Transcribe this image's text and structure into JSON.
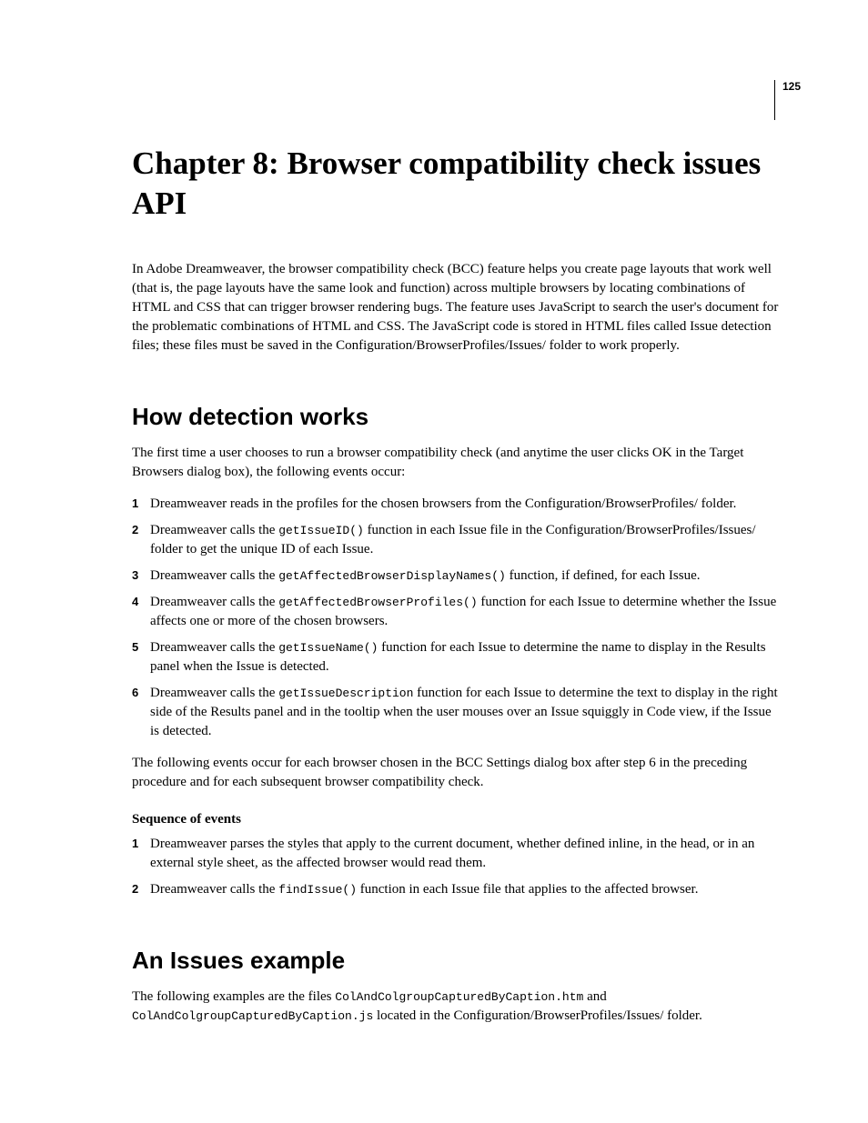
{
  "pageNumber": "125",
  "chapterTitle": "Chapter 8: Browser compatibility check issues API",
  "intro": {
    "pre": "In Adobe Dreamweaver, the browser compatibility check (BCC) feature helps you create page layouts that work well (that is, the page layouts have the same look and function) across multiple browsers by locating combinations of HTML and CSS that can trigger browser rendering bugs. The feature uses JavaScript to search the user's document for the problematic combinations of HTML and CSS. The JavaScript code is stored in HTML files called Issue detection files; these files must be saved in the Configuration/BrowserProfiles/Issues/ folder to work properly."
  },
  "section1": {
    "heading": "How detection works",
    "lead": "The first time a user chooses to run a browser compatibility check (and anytime the user clicks OK in the Target Browsers dialog box), the following events occur:",
    "items": [
      {
        "t1": "Dreamweaver reads in the profiles for the chosen browsers from the Configuration/BrowserProfiles/ folder."
      },
      {
        "t1": "Dreamweaver calls the ",
        "c1": "getIssueID()",
        "t2": " function in each Issue file in the Configuration/BrowserProfiles/Issues/ folder to get the unique ID of each Issue."
      },
      {
        "t1": "Dreamweaver calls the ",
        "c1": "getAffectedBrowserDisplayNames()",
        "t2": " function, if defined, for each Issue."
      },
      {
        "t1": "Dreamweaver calls the ",
        "c1": "getAffectedBrowserProfiles()",
        "t2": " function for each Issue to determine whether the Issue affects one or more of the chosen browsers."
      },
      {
        "t1": "Dreamweaver calls the ",
        "c1": "getIssueName()",
        "t2": " function for each Issue to determine the name to display in the Results panel when the Issue is detected."
      },
      {
        "t1": "Dreamweaver calls the ",
        "c1": "getIssueDescription",
        "t2": " function for each Issue to determine the text to display in the right side of the Results panel and in the tooltip when the user mouses over an Issue squiggly in Code view, if the Issue is detected."
      }
    ],
    "trail": "The following events occur for each browser chosen in the BCC Settings dialog box after step 6 in the preceding procedure and for each subsequent browser compatibility check.",
    "subheading": "Sequence of events",
    "seq": [
      {
        "t1": "Dreamweaver parses the styles that apply to the current document, whether defined inline, in the head, or in an external style sheet, as the affected browser would read them."
      },
      {
        "t1": "Dreamweaver calls the ",
        "c1": "findIssue()",
        "t2": " function in each Issue file that applies to the affected browser."
      }
    ]
  },
  "section2": {
    "heading": "An Issues example",
    "p": {
      "t1": "The following examples are the files ",
      "c1": "ColAndColgroupCapturedByCaption.htm",
      "t2": " and ",
      "c2": "ColAndColgroupCapturedByCaption.js",
      "t3": " located in the Configuration/BrowserProfiles/Issues/ folder."
    }
  }
}
